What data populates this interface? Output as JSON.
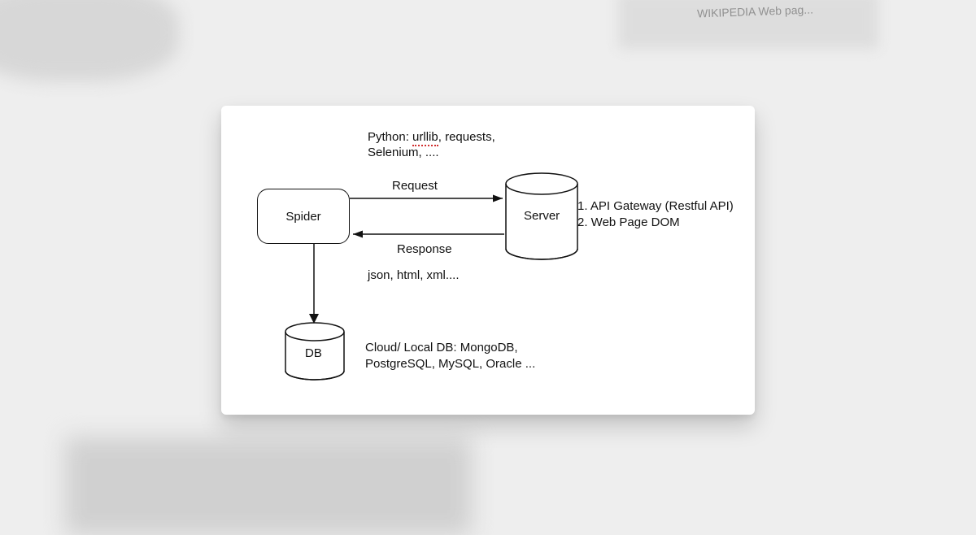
{
  "bg_text": "WIKIPEDIA   Web pag...",
  "spider": {
    "label": "Spider",
    "tools_prefix": "Python: ",
    "tools_squiggle": "urllib",
    "tools_suffix": ", requests, Selenium, ...."
  },
  "request_label": "Request",
  "response_label": "Response",
  "formats_text": "json, html, xml....",
  "server": {
    "label": "Server",
    "note1": "1. API Gateway (Restful API)",
    "note2": "2. Web Page DOM"
  },
  "db": {
    "label": "DB",
    "notes": "Cloud/ Local DB: MongoDB, PostgreSQL, MySQL, Oracle ..."
  }
}
